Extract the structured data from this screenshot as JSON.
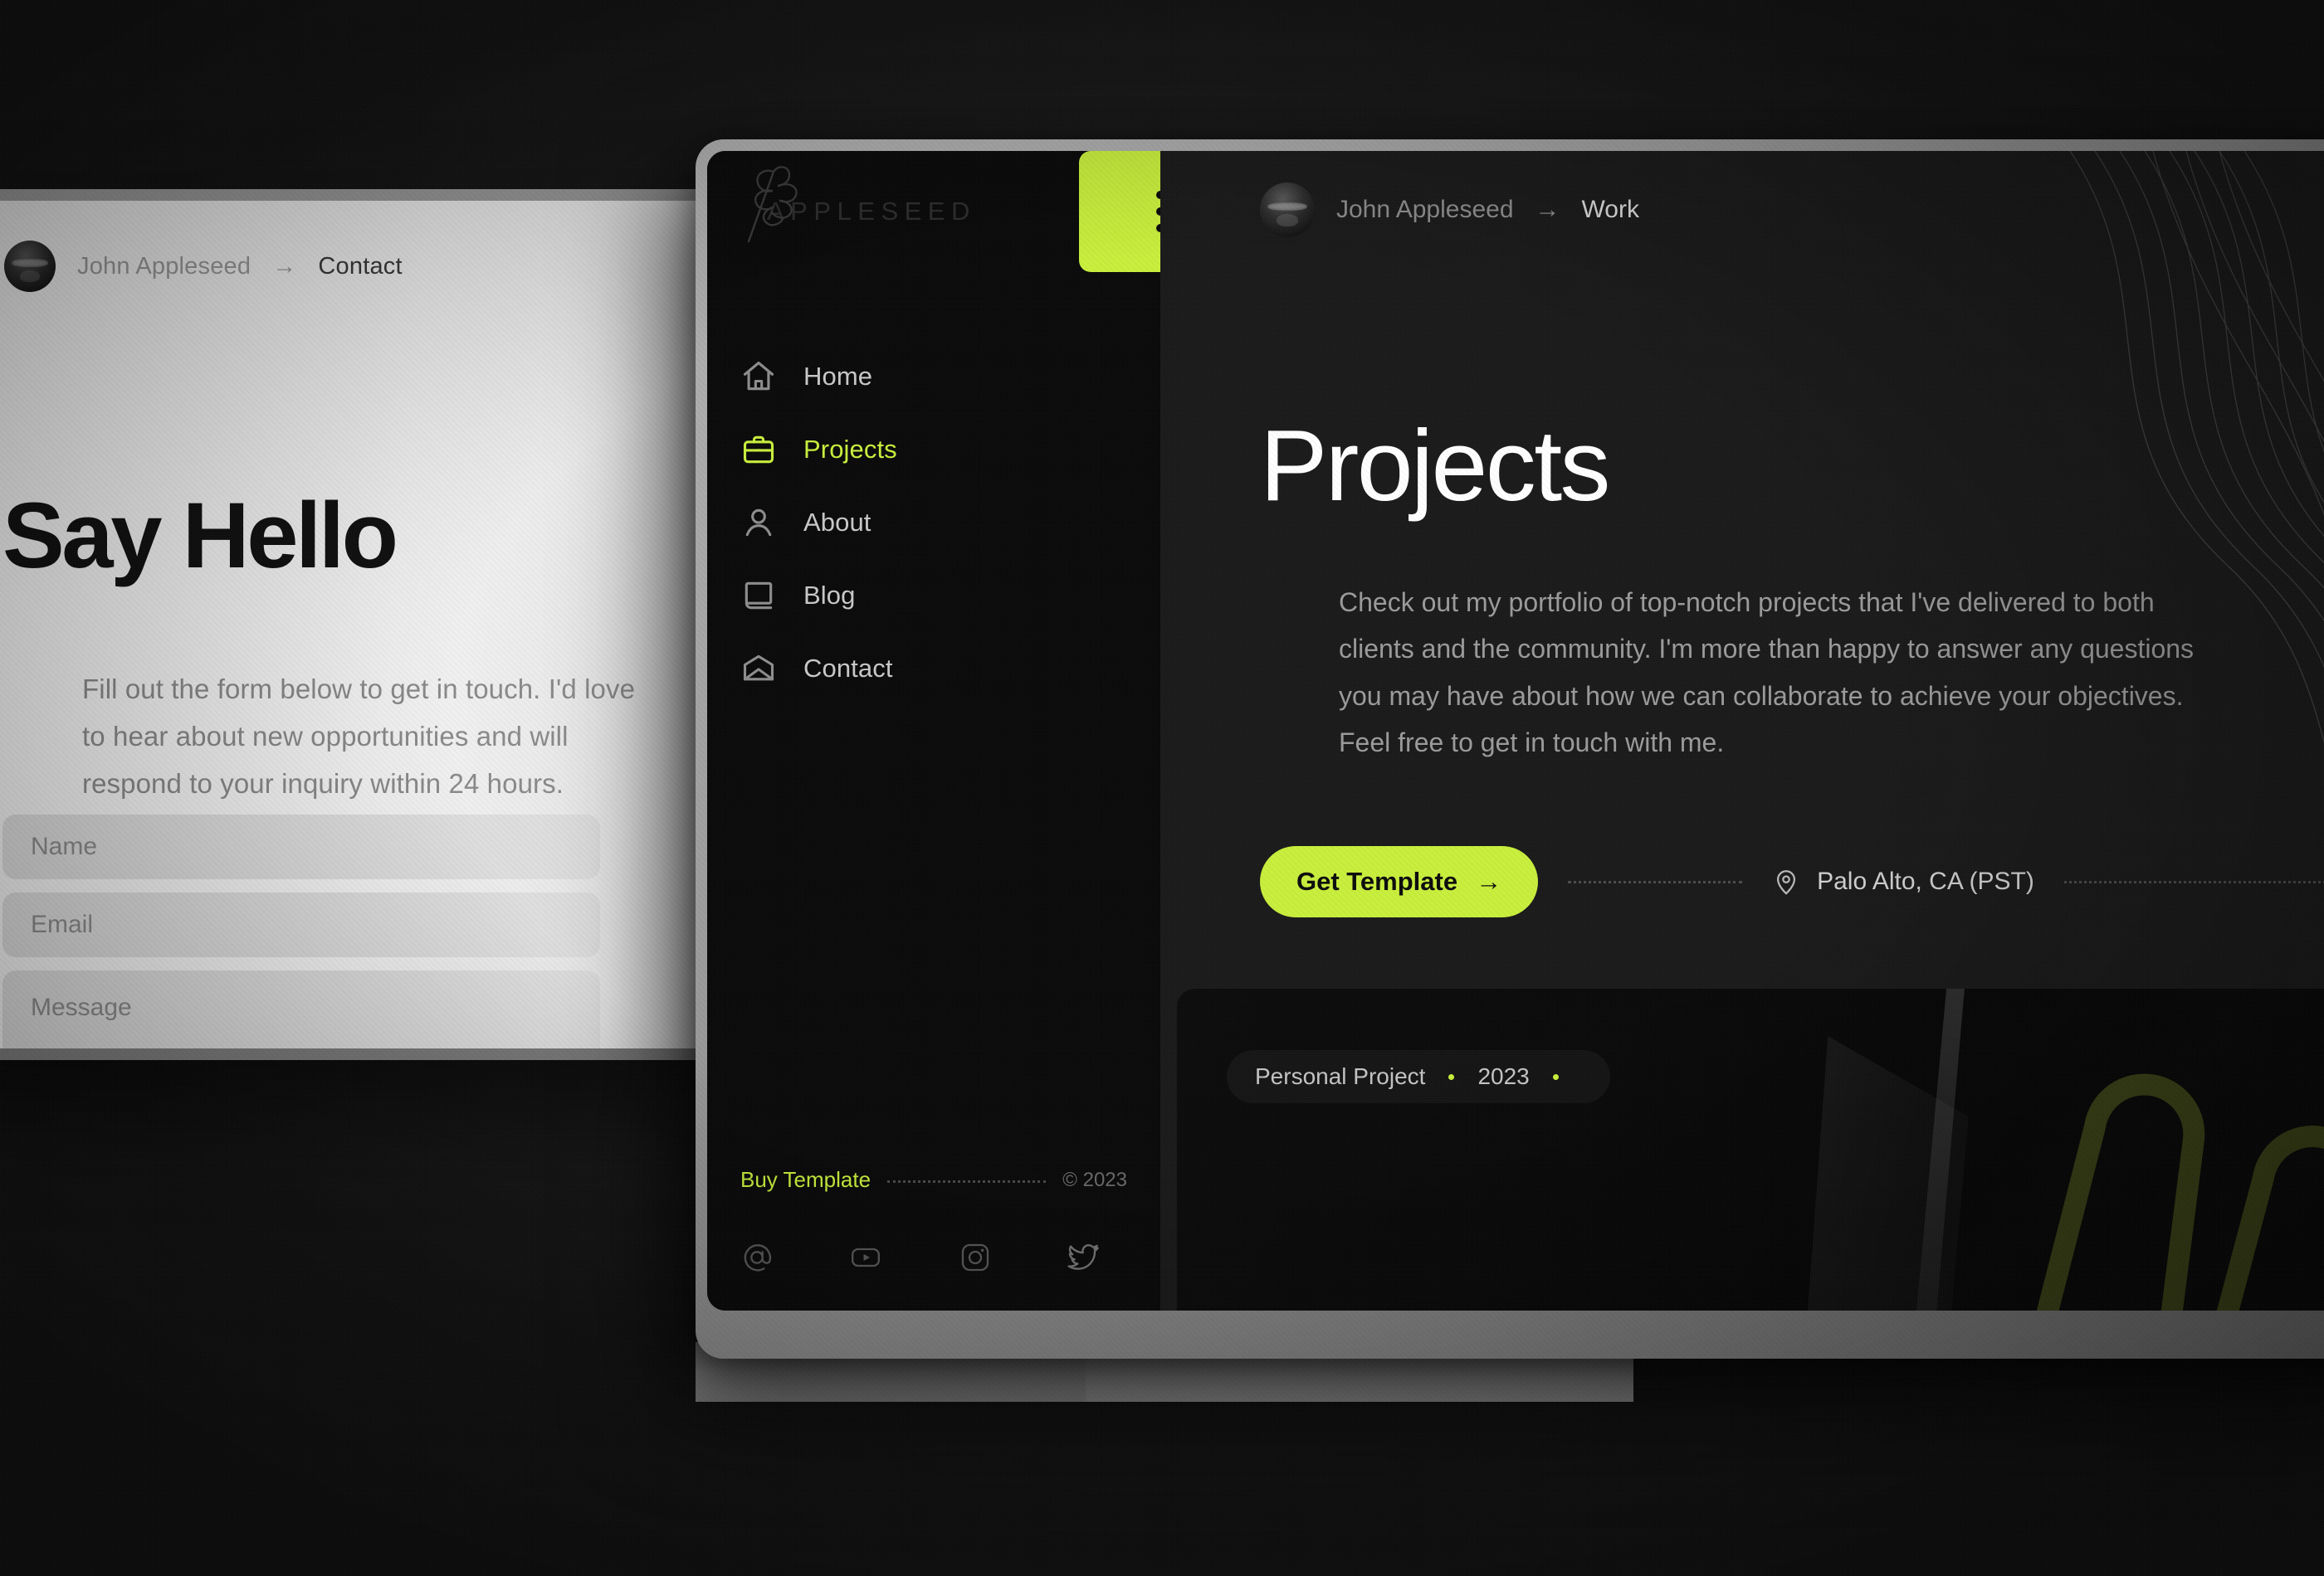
{
  "accent": {
    "lime": "#c9ef3d",
    "dark_panel": "#1b1b1b",
    "sidebar_bg": "#0b0b0b"
  },
  "laptop": {
    "breadcrumb": {
      "owner": "John Appleseed",
      "arrow": "→",
      "current": "Contact"
    },
    "title": "Say Hello",
    "paragraph": "Fill out the form below to get in touch. I'd love to hear about new opportunities and will respond to your inquiry within 24 hours.",
    "form": {
      "name_placeholder": "Name",
      "email_placeholder": "Email",
      "message_placeholder": "Message"
    }
  },
  "monitor": {
    "sidebar": {
      "logo_word": "APPLESEED",
      "menu_button": "kebab-menu",
      "nav": [
        {
          "label": "Home",
          "icon": "home-icon",
          "active": false
        },
        {
          "label": "Projects",
          "icon": "briefcase-icon",
          "active": true
        },
        {
          "label": "About",
          "icon": "user-icon",
          "active": false
        },
        {
          "label": "Blog",
          "icon": "book-icon",
          "active": false
        },
        {
          "label": "Contact",
          "icon": "envelope-icon",
          "active": false
        }
      ],
      "footer": {
        "buy_link": "Buy Template",
        "copyright": "© 2023",
        "socials": [
          "at-icon",
          "youtube-icon",
          "instagram-icon",
          "twitter-icon"
        ]
      }
    },
    "main": {
      "breadcrumb": {
        "owner": "John Appleseed",
        "arrow": "→",
        "current": "Work"
      },
      "title": "Projects",
      "paragraph": "Check out my portfolio of top-notch projects that I've delivered to both clients and the community. I'm more than happy to answer any questions you may have about how we can collaborate to achieve your objectives. Feel free to get in touch with me.",
      "cta": {
        "label": "Get Template",
        "arrow": "→"
      },
      "location": {
        "icon": "map-pin-icon",
        "label": "Palo Alto, CA (PST)"
      },
      "project_card": {
        "tag_type": "Personal Project",
        "tag_year": "2023"
      }
    }
  }
}
